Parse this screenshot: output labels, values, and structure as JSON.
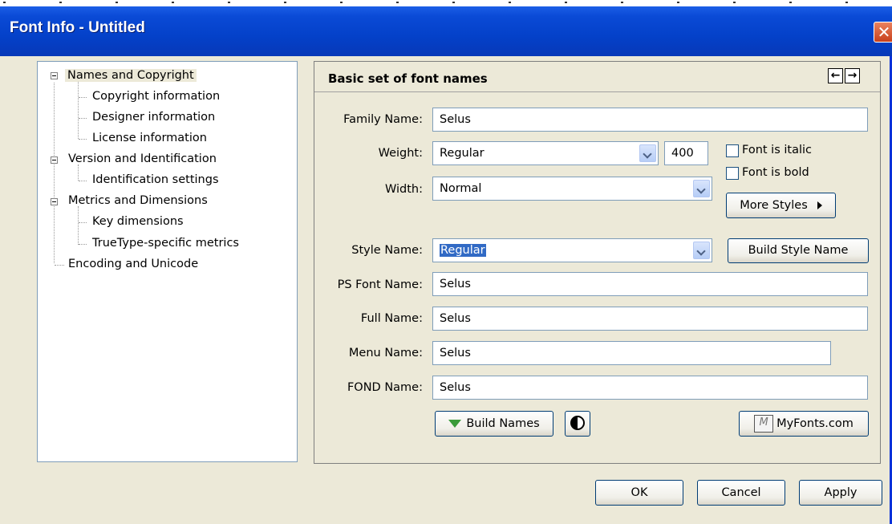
{
  "window": {
    "title": "Font Info - Untitled",
    "close_glyph": "✕"
  },
  "tree": {
    "items": [
      {
        "label": "Names and Copyright"
      },
      {
        "label": "Copyright information"
      },
      {
        "label": "Designer information"
      },
      {
        "label": "License information"
      },
      {
        "label": "Version and Identification"
      },
      {
        "label": "Identification settings"
      },
      {
        "label": "Metrics and Dimensions"
      },
      {
        "label": "Key dimensions"
      },
      {
        "label": "TrueType-specific metrics"
      },
      {
        "label": "Encoding and Unicode"
      }
    ]
  },
  "panel": {
    "title": "Basic set of font names",
    "prev_glyph": "←",
    "next_glyph": "→"
  },
  "form": {
    "family_label": "Family Name:",
    "family_value": "Selus",
    "weight_label": "Weight:",
    "weight_value": "Regular",
    "weight_number": "400",
    "width_label": "Width:",
    "width_value": "Normal",
    "italic_label": "Font is italic",
    "bold_label": "Font is bold",
    "more_styles_label": "More Styles",
    "style_label": "Style Name:",
    "style_value": "Regular",
    "build_style_label": "Build Style Name",
    "ps_label": "PS Font Name:",
    "ps_value": "Selus",
    "full_label": "Full Name:",
    "full_value": "Selus",
    "menu_label": "Menu Name:",
    "menu_value": "Selus",
    "fond_label": "FOND Name:",
    "fond_value": "Selus",
    "build_names_label": "Build Names",
    "myfonts_label": "MyFonts.com"
  },
  "footer": {
    "ok_label": "OK",
    "cancel_label": "Cancel",
    "apply_label": "Apply"
  },
  "colors": {
    "titlebar": "#0441c9",
    "selection": "#316ac5",
    "dialog_bg": "#ece9d8"
  },
  "icons": [
    "close-icon",
    "arrow-left-icon",
    "arrow-right-icon",
    "dropdown-arrow-icon",
    "gem-icon",
    "yin-yang-icon",
    "myfonts-icon",
    "triangle-right-icon"
  ]
}
